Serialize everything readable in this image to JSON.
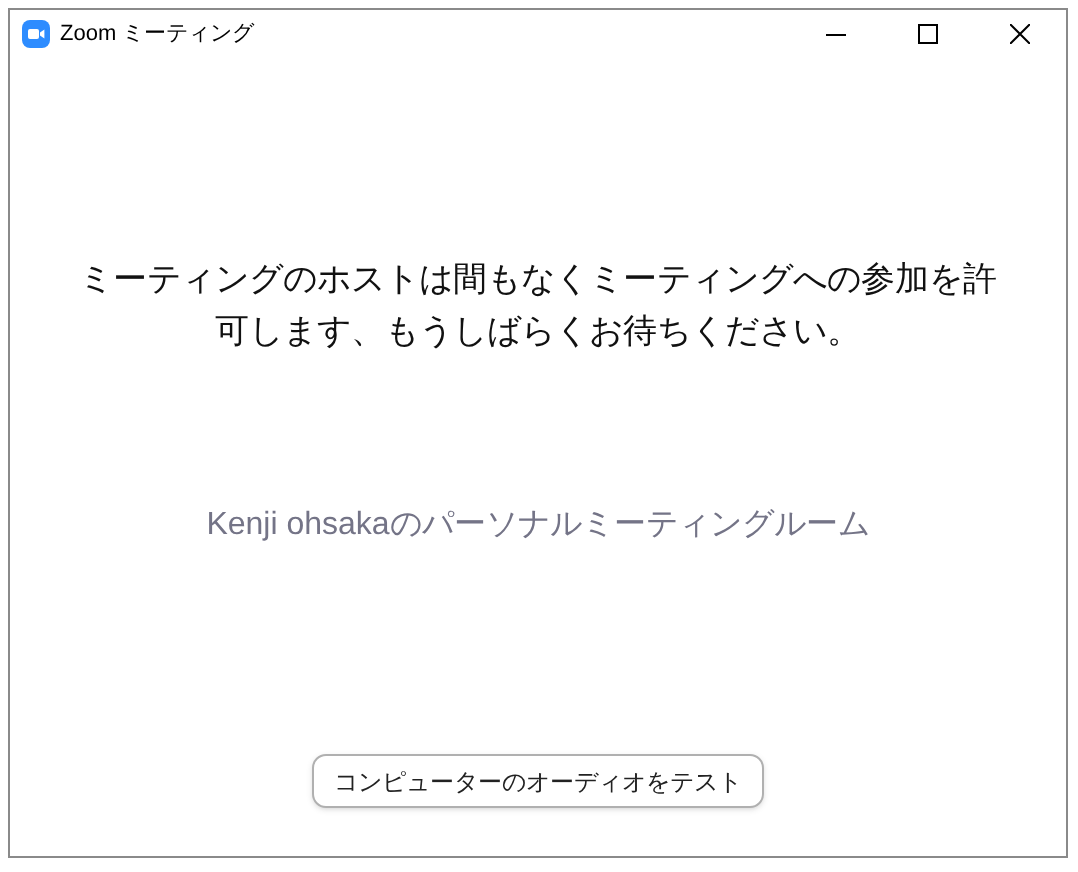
{
  "window": {
    "title": "Zoom ミーティング"
  },
  "message": "ミーティングのホストは間もなくミーティングへの参加を許可します、もうしばらくお待ちください。",
  "room_name": "Kenji ohsakaのパーソナルミーティングルーム",
  "buttons": [
    "コンピューターのオーディオをテスト"
  ]
}
